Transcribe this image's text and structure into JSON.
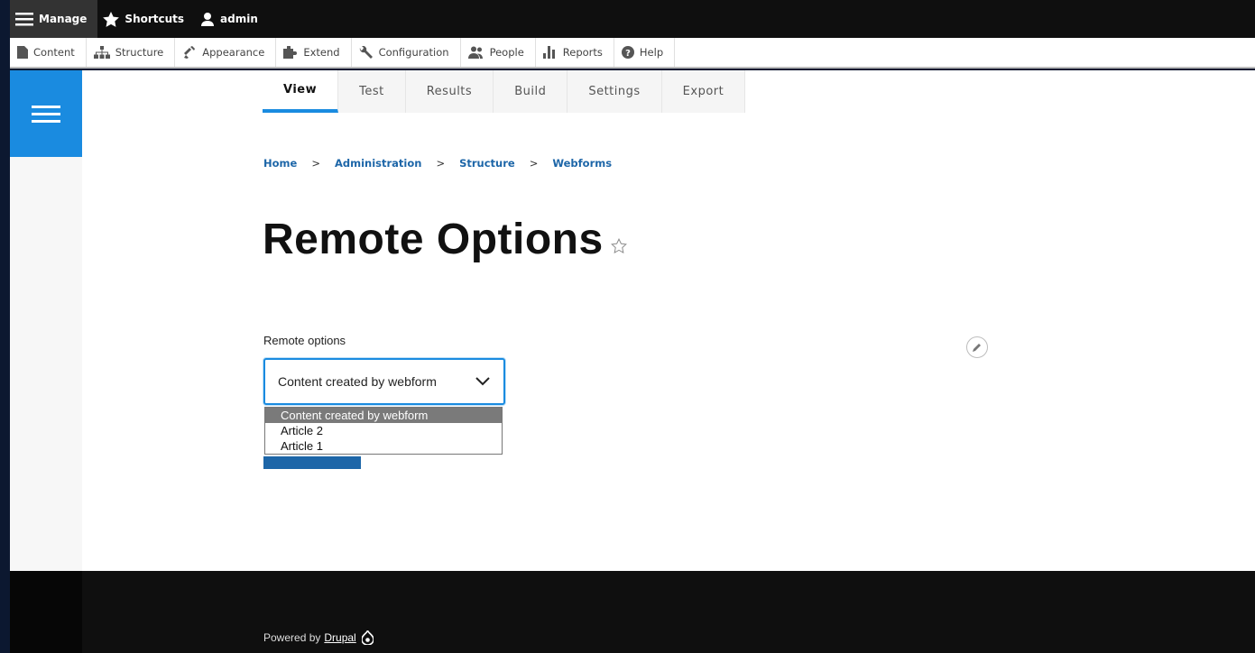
{
  "toolbar": {
    "manage_label": "Manage",
    "shortcuts_label": "Shortcuts",
    "user_label": "admin"
  },
  "tray": {
    "items": [
      {
        "label": "Content",
        "icon": "file-icon"
      },
      {
        "label": "Structure",
        "icon": "sitemap-icon"
      },
      {
        "label": "Appearance",
        "icon": "brush-icon"
      },
      {
        "label": "Extend",
        "icon": "puzzle-icon"
      },
      {
        "label": "Configuration",
        "icon": "wrench-icon"
      },
      {
        "label": "People",
        "icon": "people-icon"
      },
      {
        "label": "Reports",
        "icon": "bar-chart-icon"
      },
      {
        "label": "Help",
        "icon": "help-icon"
      }
    ]
  },
  "tabs": [
    {
      "label": "View",
      "active": true
    },
    {
      "label": "Test"
    },
    {
      "label": "Results"
    },
    {
      "label": "Build"
    },
    {
      "label": "Settings"
    },
    {
      "label": "Export"
    }
  ],
  "breadcrumb": [
    "Home",
    "Administration",
    "Structure",
    "Webforms"
  ],
  "breadcrumb_sep": ">",
  "page_title": "Remote Options",
  "form": {
    "field_label": "Remote options",
    "selected_value": "Content created by webform",
    "options": [
      "Content created by webform",
      "Article 2",
      "Article 1"
    ]
  },
  "footer": {
    "powered_by": "Powered by",
    "link": "Drupal"
  },
  "colors": {
    "accent": "#1a8be0",
    "link": "#1d66a8",
    "toolbar_bg": "#0f0f0f"
  }
}
